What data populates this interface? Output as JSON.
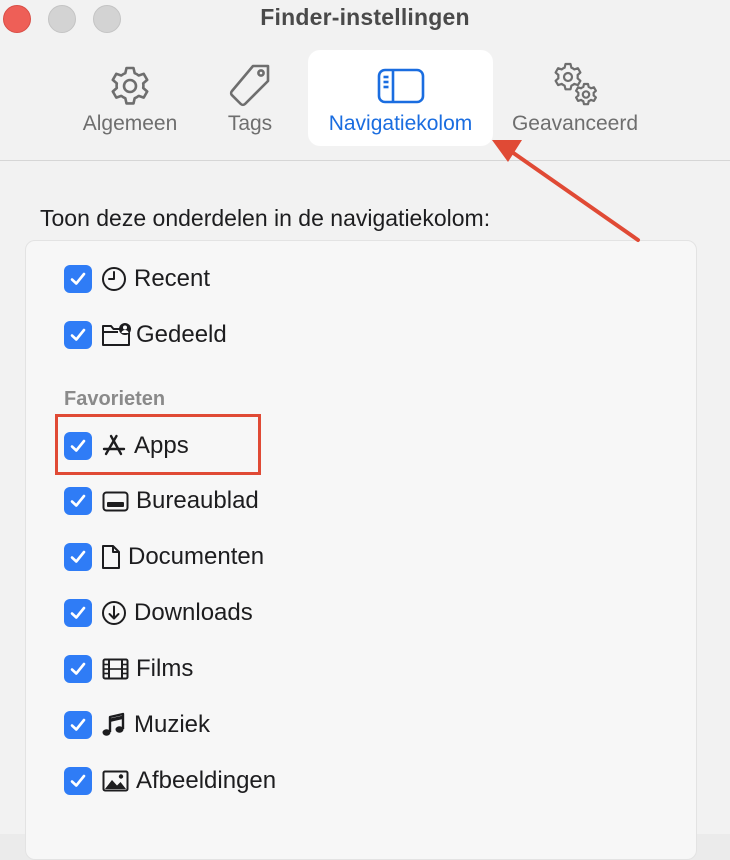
{
  "window": {
    "title": "Finder-instellingen"
  },
  "tabs": [
    {
      "label": "Algemeen",
      "icon": "gear-icon",
      "active": false
    },
    {
      "label": "Tags",
      "icon": "tag-icon",
      "active": false
    },
    {
      "label": "Navigatiekolom",
      "icon": "sidebar-icon",
      "active": true
    },
    {
      "label": "Geavanceerd",
      "icon": "gears-icon",
      "active": false
    }
  ],
  "content": {
    "heading": "Toon deze onderdelen in de navigatiekolom:",
    "top_items": [
      {
        "label": "Recent",
        "icon": "clock-icon",
        "checked": true
      },
      {
        "label": "Gedeeld",
        "icon": "shared-folder-icon",
        "checked": true
      }
    ],
    "favorites_label": "Favorieten",
    "favorites": [
      {
        "label": "Apps",
        "icon": "app-store-icon",
        "checked": true
      },
      {
        "label": "Bureaublad",
        "icon": "desktop-icon",
        "checked": true
      },
      {
        "label": "Documenten",
        "icon": "document-icon",
        "checked": true
      },
      {
        "label": "Downloads",
        "icon": "download-icon",
        "checked": true
      },
      {
        "label": "Films",
        "icon": "film-icon",
        "checked": true
      },
      {
        "label": "Muziek",
        "icon": "music-icon",
        "checked": true
      },
      {
        "label": "Afbeeldingen",
        "icon": "photo-icon",
        "checked": true
      }
    ]
  },
  "annotations": {
    "arrow_color": "#e04a35",
    "highlight_color": "#e04a35"
  },
  "colors": {
    "accent": "#2f7cf6",
    "active_tab_text": "#1a6de0"
  }
}
